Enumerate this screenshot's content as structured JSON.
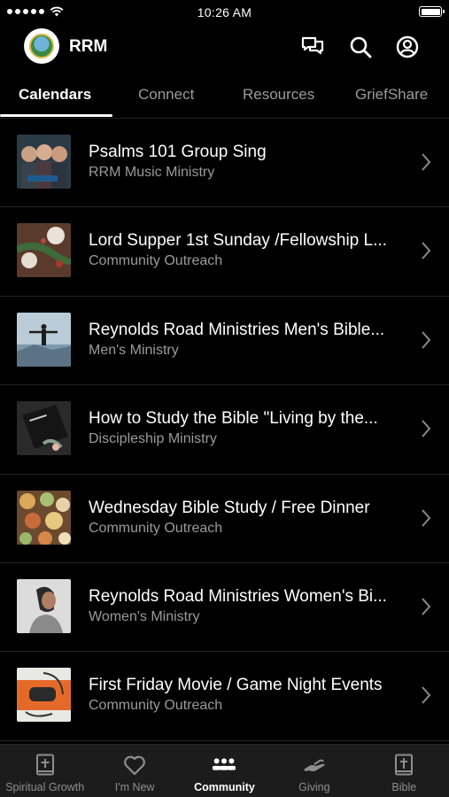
{
  "status_bar": {
    "time": "10:26 AM",
    "signal_icon": "signal-dots",
    "wifi_icon": "wifi-icon",
    "battery_icon": "battery-icon"
  },
  "header": {
    "title": "RRM",
    "icons": [
      "messages-icon",
      "search-icon",
      "account-icon"
    ]
  },
  "tabs": [
    {
      "label": "Calendars",
      "active": true
    },
    {
      "label": "Connect",
      "active": false
    },
    {
      "label": "Resources",
      "active": false
    },
    {
      "label": "GriefShare",
      "active": false
    }
  ],
  "list": [
    {
      "title": "Psalms 101 Group Sing",
      "subtitle": "RRM Music Ministry",
      "thumb": "group-photo"
    },
    {
      "title": "Lord Supper 1st Sunday /Fellowship L...",
      "subtitle": "Community Outreach",
      "thumb": "table-setting"
    },
    {
      "title": "Reynolds Road Ministries Men's Bible...",
      "subtitle": "Men's Ministry",
      "thumb": "man-on-mountain"
    },
    {
      "title": "How to Study the Bible \"Living by the...",
      "subtitle": "Discipleship Ministry",
      "thumb": "holy-bible"
    },
    {
      "title": "Wednesday Bible Study / Free Dinner",
      "subtitle": "Community Outreach",
      "thumb": "food-spread"
    },
    {
      "title": "Reynolds Road Ministries Women's Bi...",
      "subtitle": "Women's Ministry",
      "thumb": "woman-portrait"
    },
    {
      "title": "First Friday Movie / Game Night Events",
      "subtitle": "Community Outreach",
      "thumb": "game-controller"
    }
  ],
  "bottom_nav": [
    {
      "label": "Spiritual Growth",
      "icon": "book-plus-icon",
      "active": false
    },
    {
      "label": "I'm New",
      "icon": "heart-icon",
      "active": false
    },
    {
      "label": "Community",
      "icon": "people-icon",
      "active": true
    },
    {
      "label": "Giving",
      "icon": "giving-hand-icon",
      "active": false
    },
    {
      "label": "Bible",
      "icon": "bible-icon",
      "active": false
    }
  ],
  "colors": {
    "background": "#000000",
    "text_primary": "#ffffff",
    "text_secondary": "#9a9a9a",
    "nav_background": "#1c1c1c"
  }
}
